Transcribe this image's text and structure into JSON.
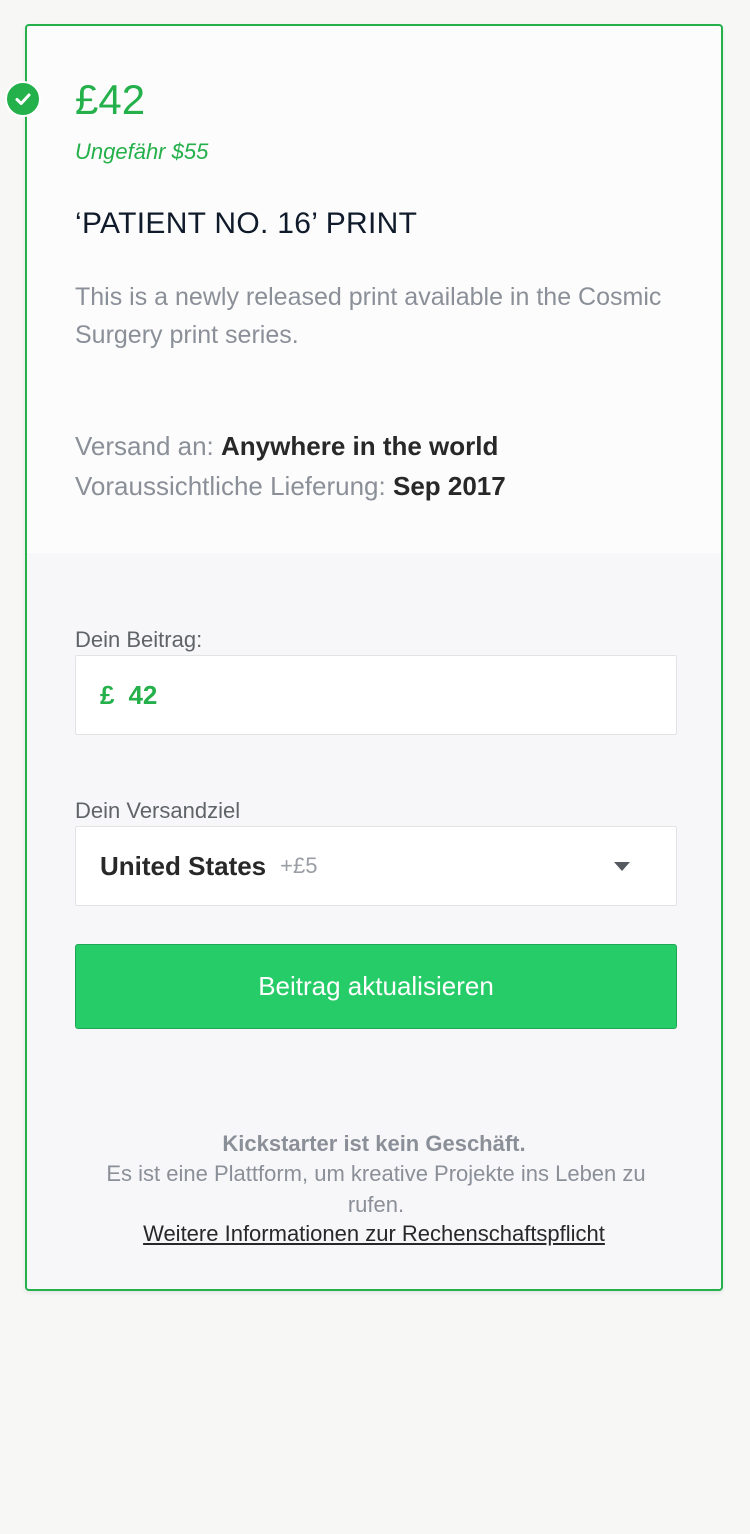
{
  "reward": {
    "price": "£42",
    "approx": "Ungefähr $55",
    "title": "‘PATIENT NO. 16’ PRINT",
    "description": "This is a newly released print available in the Cosmic Surgery print series.",
    "ships_to_label": "Versand an:",
    "ships_to_value": "Anywhere in the world",
    "delivery_label": "Voraussichtliche Lieferung:",
    "delivery_value": "Sep 2017"
  },
  "pledge_form": {
    "amount_label": "Dein Beitrag:",
    "currency_symbol": "£",
    "amount_value": "42",
    "destination_label": "Dein Versandziel",
    "destination_value": "United States",
    "destination_extra": "+£5",
    "submit_label": "Beitrag aktualisieren"
  },
  "footer": {
    "strong": "Kickstarter ist kein Geschäft.",
    "text": "Es ist eine Plattform, um kreative Projekte ins Leben zu rufen.",
    "link": "Weitere Informationen zur Rechenschaftspflicht"
  },
  "colors": {
    "accent": "#24b04b",
    "button": "#26cc67"
  },
  "icons": {
    "selected_badge": "check-circle-icon",
    "select_caret": "chevron-down-icon"
  }
}
